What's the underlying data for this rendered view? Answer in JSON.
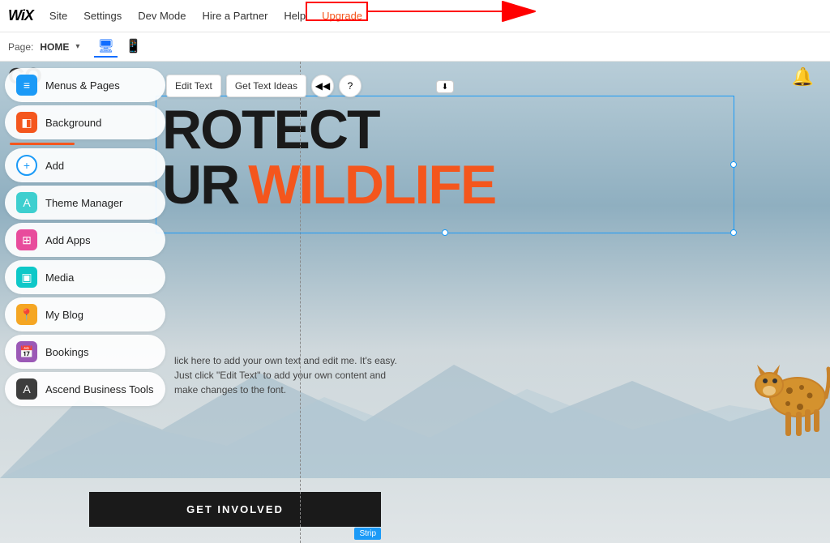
{
  "topnav": {
    "logo": "WiX",
    "items": [
      {
        "label": "Site",
        "id": "site"
      },
      {
        "label": "Settings",
        "id": "settings"
      },
      {
        "label": "Dev Mode",
        "id": "dev-mode"
      },
      {
        "label": "Hire a Partner",
        "id": "hire-partner"
      },
      {
        "label": "Help",
        "id": "help"
      },
      {
        "label": "Upgrade",
        "id": "upgrade"
      }
    ]
  },
  "pagebar": {
    "page_label": "Page:",
    "page_name": "HOME",
    "chevron": "▾"
  },
  "sidebar": {
    "items": [
      {
        "id": "menus-pages",
        "label": "Menus & Pages",
        "icon": "≡",
        "icon_class": "icon-blue"
      },
      {
        "id": "background",
        "label": "Background",
        "icon": "◧",
        "icon_class": "icon-orange"
      },
      {
        "id": "add",
        "label": "Add",
        "icon": "+",
        "icon_class": "icon-plus"
      },
      {
        "id": "theme-manager",
        "label": "Theme Manager",
        "icon": "A",
        "icon_class": "icon-teal"
      },
      {
        "id": "add-apps",
        "label": "Add Apps",
        "icon": "⊞",
        "icon_class": "icon-pink"
      },
      {
        "id": "media",
        "label": "Media",
        "icon": "▣",
        "icon_class": "icon-cyan"
      },
      {
        "id": "my-blog",
        "label": "My Blog",
        "icon": "📍",
        "icon_class": "icon-yellow"
      },
      {
        "id": "bookings",
        "label": "Bookings",
        "icon": "📅",
        "icon_class": "icon-purple"
      },
      {
        "id": "ascend-business",
        "label": "Ascend Business Tools",
        "icon": "A",
        "icon_class": "icon-dark"
      }
    ]
  },
  "canvas": {
    "hero": {
      "line1": "ROTECT",
      "line2_black": "UR",
      "line2_orange": "WILDLIFE"
    },
    "subtext": "lick here to add your own text and edit me. It's easy. Just click \"Edit Text\" to add your own content and make changes to the font.",
    "cta_button": "GET INVOLVED",
    "strip_label": "Strip"
  },
  "toolbar": {
    "edit_text": "Edit Text",
    "get_text_ideas": "Get Text Ideas"
  },
  "notification": {
    "icon": "🔔"
  },
  "logo_partial": "CO"
}
